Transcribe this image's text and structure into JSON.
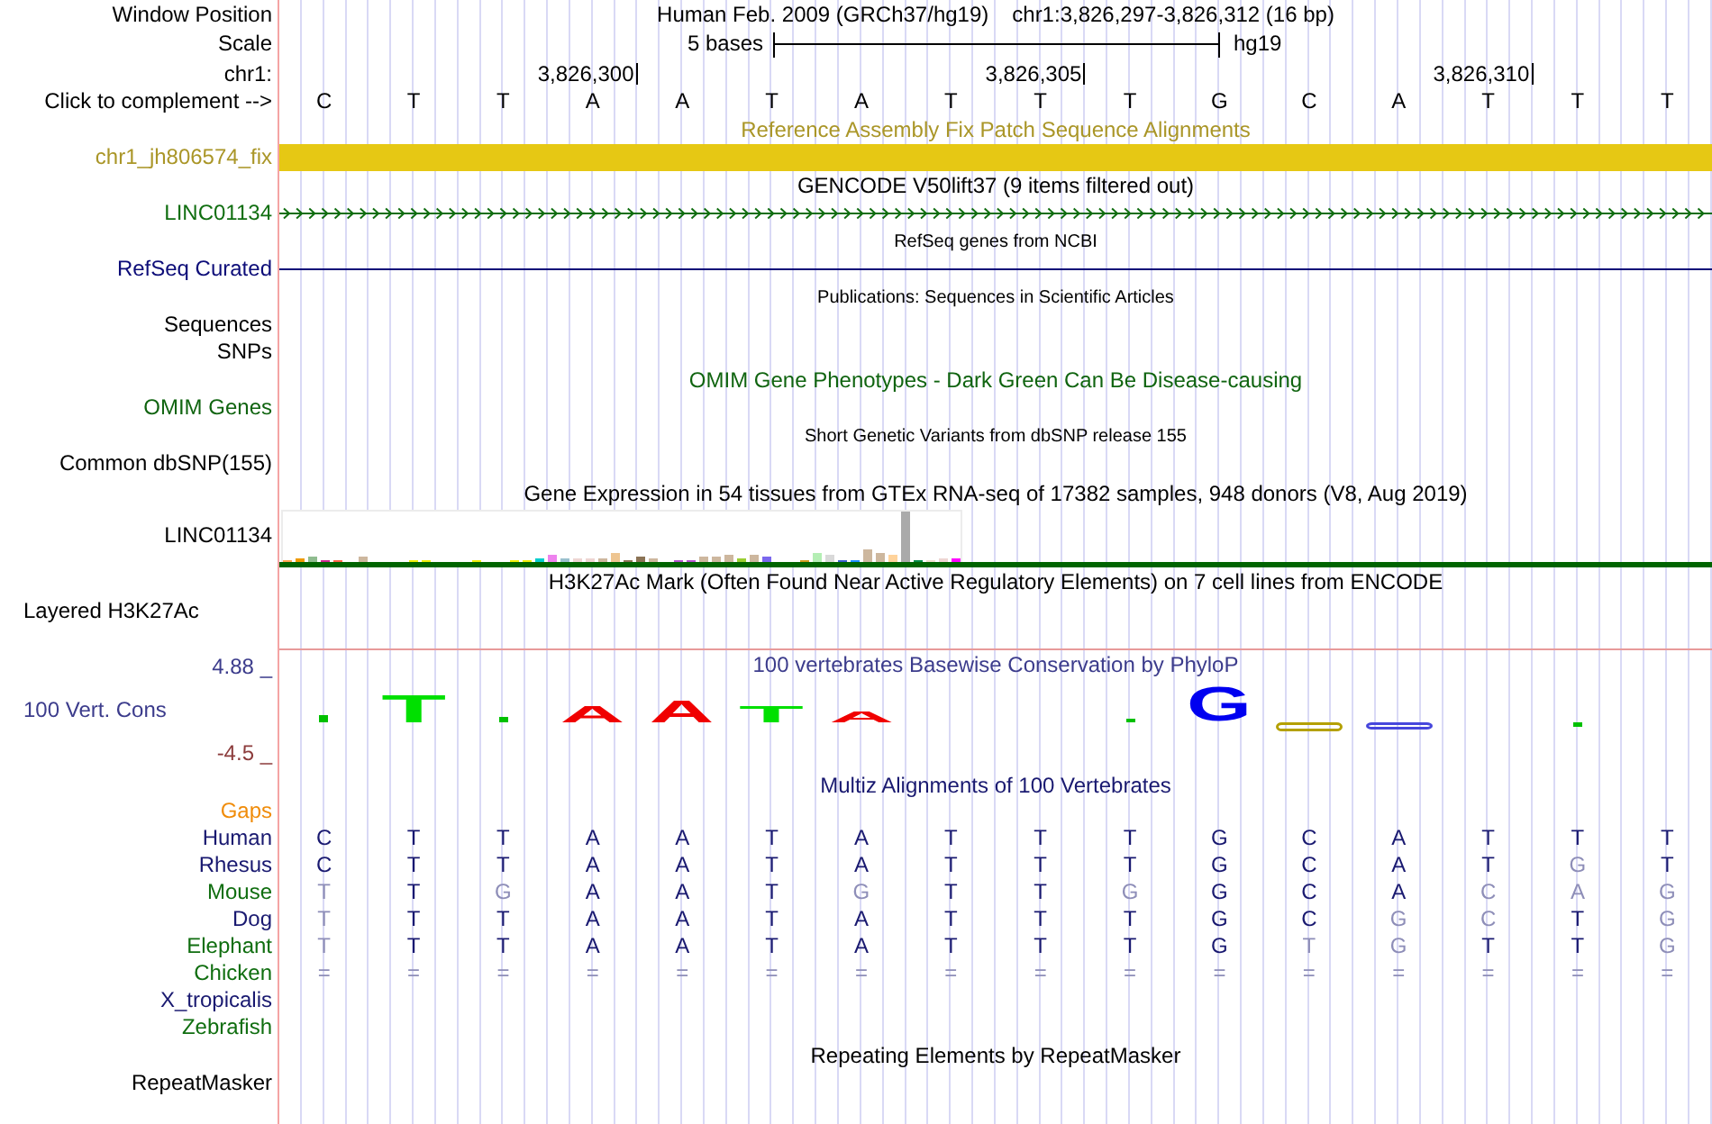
{
  "position": {
    "label": "Window Position",
    "assembly": "Human Feb. 2009 (GRCh37/hg19)",
    "range": "chr1:3,826,297-3,826,312 (16 bp)"
  },
  "scale": {
    "label": "Scale",
    "length": "5 bases",
    "assembly": "hg19"
  },
  "ruler": {
    "label": "chr1:",
    "ticks": [
      "3,826,300",
      "3,826,305",
      "3,826,310"
    ]
  },
  "sequence": {
    "label": "Click to complement -->",
    "bases": [
      "C",
      "T",
      "T",
      "A",
      "A",
      "T",
      "A",
      "T",
      "T",
      "T",
      "G",
      "C",
      "A",
      "T",
      "T",
      "T"
    ]
  },
  "tracks": [
    {
      "kind": "bar",
      "title": "Reference Assembly Fix Patch Sequence Alignments",
      "labels": [
        "chr1_jh806574_fix"
      ],
      "color": "#aa9628"
    },
    {
      "kind": "gene",
      "title": "GENCODE V50lift37 (9 items filtered out)",
      "labels": [
        "LINC01134"
      ],
      "color": "#106e10",
      "strand_arrows": true
    },
    {
      "kind": "gene",
      "title": "RefSeq genes from NCBI",
      "labels": [
        "RefSeq Curated"
      ],
      "color": "#0c0c78",
      "strand_arrows": false
    },
    {
      "kind": "empty",
      "title": "Publications: Sequences in Scientific Articles",
      "labels": [
        "Sequences",
        "SNPs"
      ]
    },
    {
      "kind": "empty",
      "title": "OMIM Gene Phenotypes - Dark Green Can Be Disease-causing",
      "labels": [
        "OMIM Genes"
      ],
      "color": "#106410"
    },
    {
      "kind": "empty",
      "title": "Short Genetic Variants from dbSNP release 155",
      "labels": [
        "Common dbSNP(155)"
      ]
    },
    {
      "kind": "expression",
      "title": "Gene Expression in 54 tissues from GTEx RNA-seq of 17382 samples, 948 donors (V8, Aug 2019)",
      "labels": [
        "LINC01134"
      ]
    },
    {
      "kind": "layered",
      "title": "H3K27Ac Mark (Often Found Near Active Regulatory Elements) on 7 cell lines from ENCODE",
      "labels": [
        "Layered H3K27Ac"
      ]
    },
    {
      "kind": "wiggle",
      "title": "100 vertebrates Basewise Conservation by PhyloP",
      "labels": [
        "100 Vert. Cons"
      ],
      "color": "#3c3c8c",
      "axis_max": "4.88 _",
      "axis_min": "-4.5 _",
      "logo": [
        {
          "kind": "mark",
          "color": "#00c000"
        },
        {
          "kind": "letter",
          "base": "T",
          "color": "#00e000"
        },
        {
          "kind": "mark",
          "color": "#00c000"
        },
        {
          "kind": "letter",
          "base": "A",
          "color": "#f00000"
        },
        {
          "kind": "letter",
          "base": "A",
          "color": "#f00000"
        },
        {
          "kind": "letter",
          "base": "T",
          "color": "#00e000"
        },
        {
          "kind": "letter",
          "base": "A",
          "color": "#f00000"
        },
        {
          "kind": "none"
        },
        {
          "kind": "none"
        },
        {
          "kind": "mark",
          "color": "#00c000"
        },
        {
          "kind": "letter",
          "base": "G",
          "color": "#0000f0"
        },
        {
          "kind": "band",
          "color": "#b4a000"
        },
        {
          "kind": "band",
          "color": "#4646dc"
        },
        {
          "kind": "none"
        },
        {
          "kind": "mark",
          "color": "#00c000"
        },
        {
          "kind": "none"
        }
      ]
    },
    {
      "kind": "multiz",
      "title": "Multiz Alignments of 100 Vertebrates",
      "color": "#191970",
      "gaps": {
        "label": "Gaps",
        "color": "#f08c0a"
      },
      "species": [
        {
          "name": "Human",
          "color": "#191970",
          "bases": [
            {
              "base": "C",
              "match": true
            },
            {
              "base": "T",
              "match": true
            },
            {
              "base": "T",
              "match": true
            },
            {
              "base": "A",
              "match": true
            },
            {
              "base": "A",
              "match": true
            },
            {
              "base": "T",
              "match": true
            },
            {
              "base": "A",
              "match": true
            },
            {
              "base": "T",
              "match": true
            },
            {
              "base": "T",
              "match": true
            },
            {
              "base": "T",
              "match": true
            },
            {
              "base": "G",
              "match": true
            },
            {
              "base": "C",
              "match": true
            },
            {
              "base": "A",
              "match": true
            },
            {
              "base": "T",
              "match": true
            },
            {
              "base": "T",
              "match": true
            },
            {
              "base": "T",
              "match": true
            }
          ]
        },
        {
          "name": "Rhesus",
          "color": "#191970",
          "bases": [
            {
              "base": "C",
              "match": true
            },
            {
              "base": "T",
              "match": true
            },
            {
              "base": "T",
              "match": true
            },
            {
              "base": "A",
              "match": true
            },
            {
              "base": "A",
              "match": true
            },
            {
              "base": "T",
              "match": true
            },
            {
              "base": "A",
              "match": true
            },
            {
              "base": "T",
              "match": true
            },
            {
              "base": "T",
              "match": true
            },
            {
              "base": "T",
              "match": true
            },
            {
              "base": "G",
              "match": true
            },
            {
              "base": "C",
              "match": true
            },
            {
              "base": "A",
              "match": true
            },
            {
              "base": "T",
              "match": true
            },
            {
              "base": "G",
              "match": false
            },
            {
              "base": "T",
              "match": true
            }
          ]
        },
        {
          "name": "Mouse",
          "color": "#106e10",
          "bases": [
            {
              "base": "T",
              "match": false
            },
            {
              "base": "T",
              "match": true
            },
            {
              "base": "G",
              "match": false
            },
            {
              "base": "A",
              "match": true
            },
            {
              "base": "A",
              "match": true
            },
            {
              "base": "T",
              "match": true
            },
            {
              "base": "G",
              "match": false
            },
            {
              "base": "T",
              "match": true
            },
            {
              "base": "T",
              "match": true
            },
            {
              "base": "G",
              "match": false
            },
            {
              "base": "G",
              "match": true
            },
            {
              "base": "C",
              "match": true
            },
            {
              "base": "A",
              "match": true
            },
            {
              "base": "C",
              "match": false
            },
            {
              "base": "A",
              "match": false
            },
            {
              "base": "G",
              "match": false
            }
          ]
        },
        {
          "name": "Dog",
          "color": "#191970",
          "bases": [
            {
              "base": "T",
              "match": false
            },
            {
              "base": "T",
              "match": true
            },
            {
              "base": "T",
              "match": true
            },
            {
              "base": "A",
              "match": true
            },
            {
              "base": "A",
              "match": true
            },
            {
              "base": "T",
              "match": true
            },
            {
              "base": "A",
              "match": true
            },
            {
              "base": "T",
              "match": true
            },
            {
              "base": "T",
              "match": true
            },
            {
              "base": "T",
              "match": true
            },
            {
              "base": "G",
              "match": true
            },
            {
              "base": "C",
              "match": true
            },
            {
              "base": "G",
              "match": false
            },
            {
              "base": "C",
              "match": false
            },
            {
              "base": "T",
              "match": true
            },
            {
              "base": "G",
              "match": false
            }
          ]
        },
        {
          "name": "Elephant",
          "color": "#106e10",
          "bases": [
            {
              "base": "T",
              "match": false
            },
            {
              "base": "T",
              "match": true
            },
            {
              "base": "T",
              "match": true
            },
            {
              "base": "A",
              "match": true
            },
            {
              "base": "A",
              "match": true
            },
            {
              "base": "T",
              "match": true
            },
            {
              "base": "A",
              "match": true
            },
            {
              "base": "T",
              "match": true
            },
            {
              "base": "T",
              "match": true
            },
            {
              "base": "T",
              "match": true
            },
            {
              "base": "G",
              "match": true
            },
            {
              "base": "T",
              "match": false
            },
            {
              "base": "G",
              "match": false
            },
            {
              "base": "T",
              "match": true
            },
            {
              "base": "T",
              "match": true
            },
            {
              "base": "G",
              "match": false
            }
          ]
        },
        {
          "name": "Chicken",
          "color": "#106e10",
          "bases": [
            {
              "base": "=",
              "match": false
            },
            {
              "base": "=",
              "match": false
            },
            {
              "base": "=",
              "match": false
            },
            {
              "base": "=",
              "match": false
            },
            {
              "base": "=",
              "match": false
            },
            {
              "base": "=",
              "match": false
            },
            {
              "base": "=",
              "match": false
            },
            {
              "base": "=",
              "match": false
            },
            {
              "base": "=",
              "match": false
            },
            {
              "base": "=",
              "match": false
            },
            {
              "base": "=",
              "match": false
            },
            {
              "base": "=",
              "match": false
            },
            {
              "base": "=",
              "match": false
            },
            {
              "base": "=",
              "match": false
            },
            {
              "base": "=",
              "match": false
            },
            {
              "base": "=",
              "match": false
            }
          ]
        },
        {
          "name": "X_tropicalis",
          "color": "#191970"
        },
        {
          "name": "Zebrafish",
          "color": "#106e10"
        }
      ]
    },
    {
      "kind": "empty",
      "title": "Repeating Elements by RepeatMasker",
      "labels": [
        "RepeatMasker"
      ]
    }
  ]
}
